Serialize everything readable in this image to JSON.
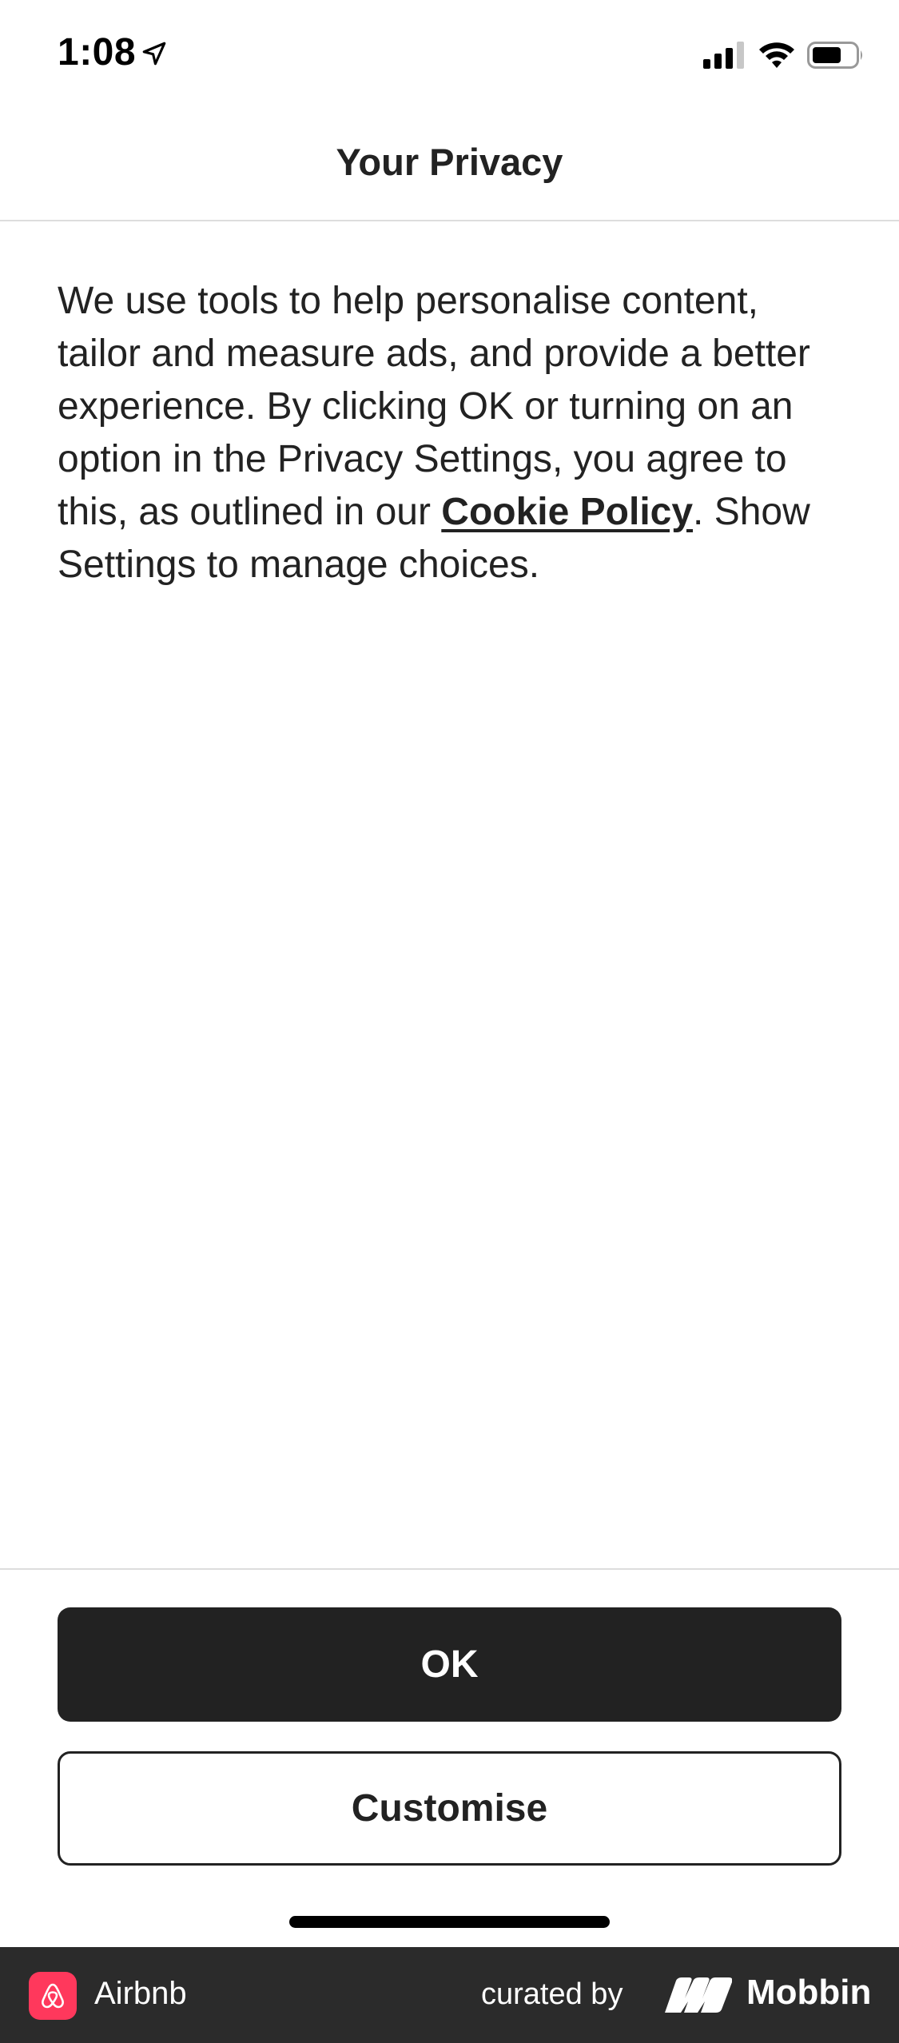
{
  "status_bar": {
    "time": "1:08"
  },
  "header": {
    "title": "Your Privacy"
  },
  "body": {
    "text_before_link": "We use tools to help personalise content, tailor and measure ads, and provide a better experience. By clicking OK or turning on an option in the Privacy Settings, you agree to this, as outlined in our ",
    "link_label": "Cookie Policy",
    "text_after_link": ". Show Settings to manage choices."
  },
  "actions": {
    "ok_label": "OK",
    "customise_label": "Customise"
  },
  "attribution": {
    "app_name": "Airbnb",
    "curated_by": "curated by",
    "brand": "Mobbin"
  },
  "icons": {
    "location": "location-arrow-icon",
    "signal": "cellular-signal-icon",
    "wifi": "wifi-icon",
    "battery": "battery-icon",
    "app_logo": "airbnb-logo-icon",
    "brand_logo": "mobbin-logo-icon"
  },
  "colors": {
    "primary_button": "#222222",
    "brand_accent": "#FF385C",
    "attribution_bar": "#2B2B2B"
  }
}
